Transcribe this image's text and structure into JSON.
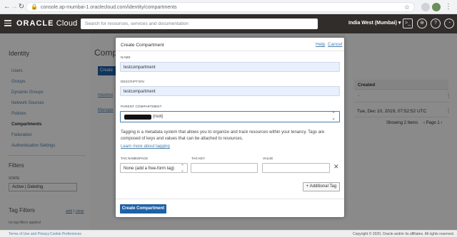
{
  "browser": {
    "url": "console.ap-mumbai-1.oraclecloud.com/identity/compartments"
  },
  "header": {
    "brand_prefix": "ORACLE",
    "brand_suffix": " Cloud",
    "search_placeholder": "Search for resources, services and documentation",
    "region": "India West (Mumbai)"
  },
  "sidebar": {
    "title": "Identity",
    "items": [
      {
        "label": "Users"
      },
      {
        "label": "Groups"
      },
      {
        "label": "Dynamic Groups"
      },
      {
        "label": "Network Sources"
      },
      {
        "label": "Policies"
      },
      {
        "label": "Compartments",
        "active": true
      },
      {
        "label": "Federation"
      },
      {
        "label": "Authentication Settings"
      }
    ],
    "filters_title": "Filters",
    "state_label": "STATE",
    "state_value": "Active | Deleting",
    "tag_filters_title": "Tag Filters",
    "tag_add": "add",
    "tag_sep": " | ",
    "tag_clear": "clear",
    "no_tags": "no tag filters applied"
  },
  "main": {
    "title": "Comp",
    "create_button": "Create",
    "row1_name": "mosmvt",
    "row2_name": "Manage",
    "created_header": "Created",
    "row1_created": "-",
    "row2_created": "Tue, Dec 10, 2019, 07:52:52 UTC",
    "showing": "Showing 2 Items",
    "page": "Page 1"
  },
  "modal": {
    "title": "Create Compartment",
    "help": "Help",
    "cancel": "Cancel",
    "name_label": "NAME",
    "name_value": "testcompartment",
    "description_label": "DESCRIPTION",
    "description_value": "testcompartment",
    "parent_label": "PARENT COMPARTMENT",
    "parent_suffix": "(root)",
    "tagging_text": "Tagging is a metadata system that allows you to organize and track resources within your tenancy. Tags are composed of keys and values that can be attached to resources.",
    "learn_more": "Learn more about tagging",
    "tag_namespace_label": "TAG NAMESPACE",
    "tag_key_label": "TAG KEY",
    "value_label": "VALUE",
    "namespace_value": "None (add a free-form tag)",
    "add_tag": "+ Additional Tag",
    "create_button": "Create Compartment"
  },
  "footer": {
    "terms": "Terms of Use and Privacy",
    "cookies": "Cookie Preferences",
    "copyright": "Copyright © 2020, Oracle and/or its affiliates. All rights reserved."
  }
}
